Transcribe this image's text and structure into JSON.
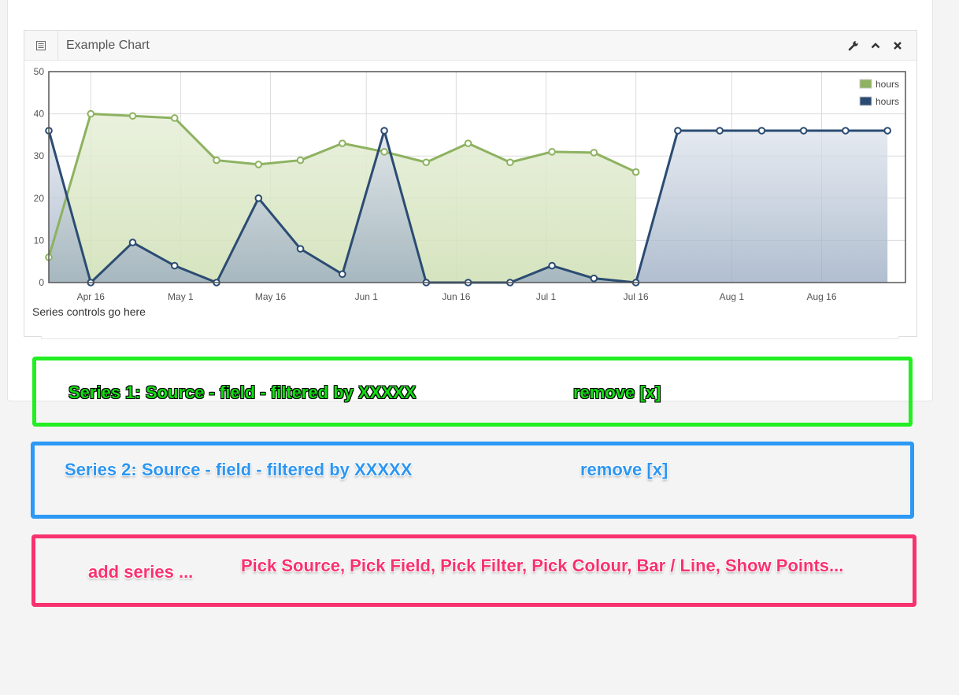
{
  "widget": {
    "title": "Example Chart",
    "icons": [
      "list-icon",
      "wrench-icon",
      "chevron-up-icon",
      "close-icon"
    ],
    "controls_placeholder": "Series controls go here"
  },
  "chart_data": {
    "type": "area",
    "ylim": [
      0,
      50
    ],
    "y_ticks": [
      0,
      10,
      20,
      30,
      40,
      50
    ],
    "x_tick_labels": [
      "Apr 16",
      "May 1",
      "May 16",
      "Jun 1",
      "Jun 16",
      "Jul 1",
      "Jul 16",
      "Aug 1",
      "Aug 16"
    ],
    "x_range": [
      "Apr 9",
      "Aug 30"
    ],
    "grid": true,
    "legend_position": "top-right",
    "series": [
      {
        "name": "hours",
        "color": "#8db260",
        "x": [
          "Apr 9",
          "Apr 16",
          "Apr 23",
          "Apr 30",
          "May 7",
          "May 14",
          "May 21",
          "May 28",
          "Jun 4",
          "Jun 11",
          "Jun 18",
          "Jun 25",
          "Jul 2",
          "Jul 9",
          "Jul 16"
        ],
        "values": [
          6,
          40,
          39.5,
          39,
          29,
          28,
          29,
          33,
          31,
          28.5,
          33,
          28.5,
          31,
          30.8,
          26.2
        ]
      },
      {
        "name": "hours",
        "color": "#2b4c72",
        "x": [
          "Apr 9",
          "Apr 16",
          "Apr 23",
          "Apr 30",
          "May 7",
          "May 14",
          "May 21",
          "May 28",
          "Jun 4",
          "Jun 11",
          "Jun 18",
          "Jun 25",
          "Jul 2",
          "Jul 9",
          "Jul 16",
          "Jul 23",
          "Jul 30",
          "Aug 6",
          "Aug 13",
          "Aug 20",
          "Aug 27"
        ],
        "values": [
          36,
          0,
          9.5,
          4,
          0,
          20,
          8,
          2,
          36,
          0,
          0,
          0,
          4,
          1,
          0,
          36,
          36,
          36,
          36,
          36,
          36
        ]
      }
    ]
  },
  "annotations": {
    "series1": {
      "text": "Series 1: Source - field - filtered by XXXXX",
      "remove": "remove [x]",
      "color": "#22ee22"
    },
    "series2": {
      "text": "Series 2: Source - field - filtered by XXXXX",
      "remove": "remove [x]",
      "color": "#2b99f5"
    },
    "add": {
      "text": "add series ...",
      "options": "Pick Source, Pick Field, Pick Filter, Pick Colour, Bar / Line, Show Points...",
      "color": "#f8326f"
    }
  }
}
